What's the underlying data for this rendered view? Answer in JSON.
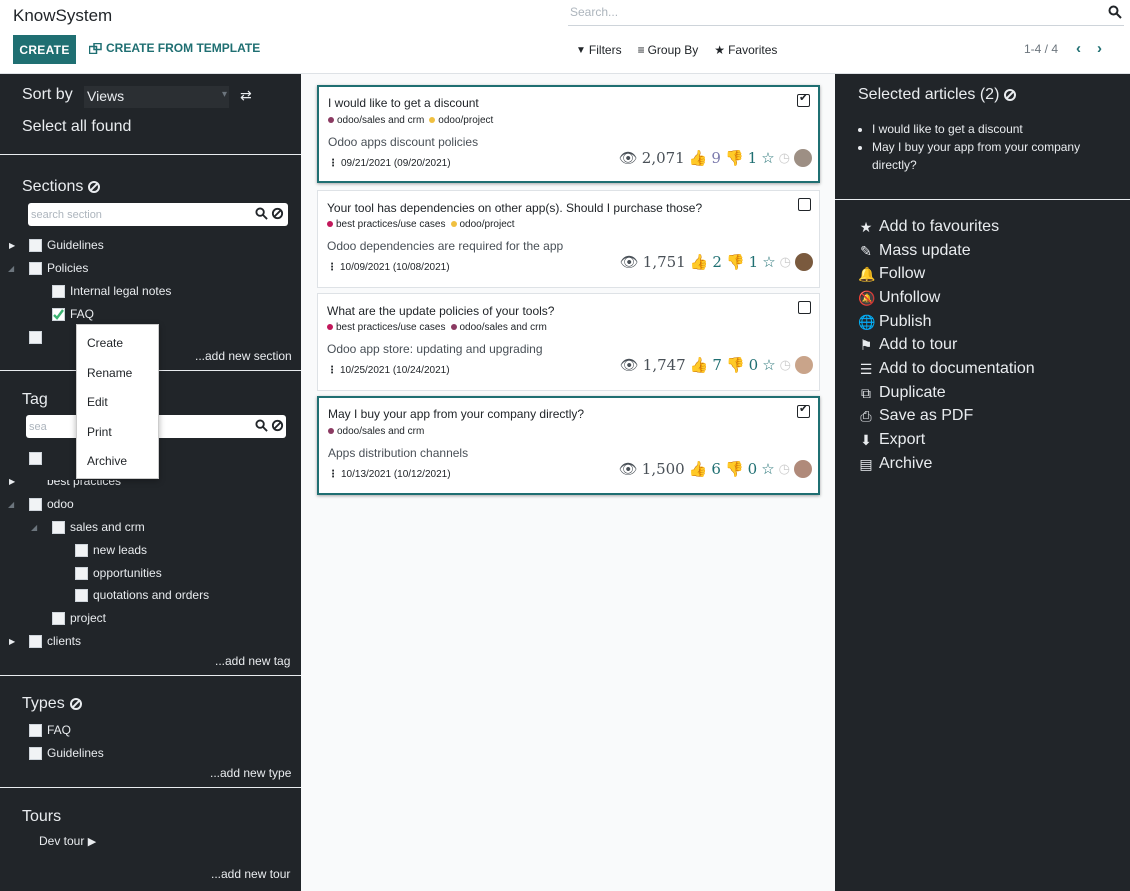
{
  "app": {
    "title": "KnowSystem"
  },
  "search": {
    "placeholder": "Search..."
  },
  "toolbar": {
    "create_label": "CREATE",
    "template_label": "CREATE FROM TEMPLATE",
    "filters_label": "Filters",
    "groupby_label": "Group By",
    "favorites_label": "Favorites",
    "pager": "1-4 / 4"
  },
  "left": {
    "sort_label": "Sort by",
    "sort_value": "Views",
    "select_all": "Select all found",
    "sections": {
      "title": "Sections",
      "search_placeholder": "search section",
      "items": [
        "Guidelines",
        "Policies",
        "Internal legal notes",
        "FAQ"
      ],
      "add_new": "...add new section"
    },
    "tags": {
      "title": "Tag",
      "search_placeholder": "sea",
      "items": [
        "best practices",
        "odoo",
        "sales and crm",
        "new leads",
        "opportunities",
        "quotations and orders",
        "project",
        "clients"
      ],
      "add_new": "...add new tag"
    },
    "types": {
      "title": "Types",
      "items": [
        "FAQ",
        "Guidelines"
      ],
      "add_new": "...add new type"
    },
    "tours": {
      "title": "Tours",
      "items": [
        "Dev tour"
      ],
      "add_new": "...add new tour"
    }
  },
  "context_menu": {
    "items": [
      "Create",
      "Rename",
      "Edit",
      "Print",
      "Archive"
    ]
  },
  "articles": [
    {
      "title": "I would like to get a discount",
      "tags": [
        {
          "label": "odoo/sales and crm",
          "color": "#8b3a62"
        },
        {
          "label": "odoo/project",
          "color": "#f0c040"
        }
      ],
      "desc": "Odoo apps discount policies",
      "date": "09/21/2021 (09/20/2021)",
      "views": "2,071",
      "likes": "9",
      "dislikes": "1",
      "selected": true
    },
    {
      "title": "Your tool has dependencies on other app(s). Should I purchase those?",
      "tags": [
        {
          "label": "best practices/use cases",
          "color": "#c2185b"
        },
        {
          "label": "odoo/project",
          "color": "#f0c040"
        }
      ],
      "desc": "Odoo dependencies are required for the app",
      "date": "10/09/2021 (10/08/2021)",
      "views": "1,751",
      "likes": "2",
      "dislikes": "1",
      "selected": false
    },
    {
      "title": "What are the update policies of your tools?",
      "tags": [
        {
          "label": "best practices/use cases",
          "color": "#c2185b"
        },
        {
          "label": "odoo/sales and crm",
          "color": "#8b3a62"
        }
      ],
      "desc": "Odoo app store: updating and upgrading",
      "date": "10/25/2021 (10/24/2021)",
      "views": "1,747",
      "likes": "7",
      "dislikes": "0",
      "selected": false
    },
    {
      "title": "May I buy your app from your company directly?",
      "tags": [
        {
          "label": "odoo/sales and crm",
          "color": "#8b3a62"
        }
      ],
      "desc": "Apps distribution channels",
      "date": "10/13/2021 (10/12/2021)",
      "views": "1,500",
      "likes": "6",
      "dislikes": "0",
      "selected": true
    }
  ],
  "right": {
    "title": "Selected articles (2)",
    "selected": [
      "I would like to get a discount",
      "May I buy your app from your company directly?"
    ],
    "actions": [
      "Add to favourites",
      "Mass update",
      "Follow",
      "Unfollow",
      "Publish",
      "Add to tour",
      "Add to documentation",
      "Duplicate",
      "Save as PDF",
      "Export",
      "Archive"
    ]
  },
  "colors": {
    "accent": "#1f6f72",
    "panel": "#212529"
  }
}
